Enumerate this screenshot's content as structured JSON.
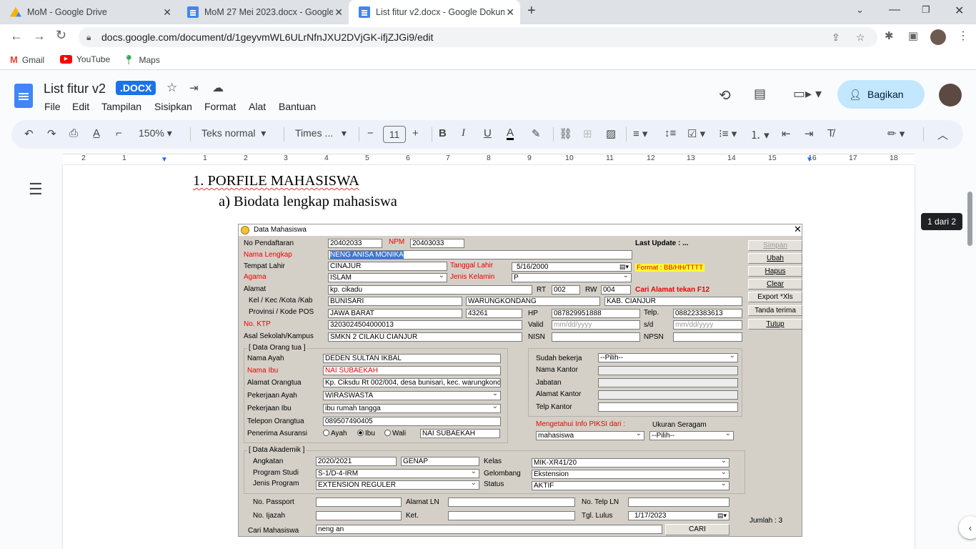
{
  "browser": {
    "tabs": [
      {
        "title": "MoM - Google Drive",
        "icon": "google-drive-icon"
      },
      {
        "title": "MoM 27 Mei 2023.docx - Google...",
        "icon": "google-docs-icon"
      },
      {
        "title": "List fitur v2.docx - Google Dokum...",
        "icon": "google-docs-icon"
      }
    ],
    "url": "docs.google.com/document/d/1geyvmWL6ULrNfnJXU2DVjGK-ifjZJGi9/edit",
    "bookmarks": [
      "Gmail",
      "YouTube",
      "Maps"
    ]
  },
  "docs": {
    "title": "List fitur v2",
    "badge": ".DOCX",
    "menu": [
      "File",
      "Edit",
      "Tampilan",
      "Sisipkan",
      "Format",
      "Alat",
      "Bantuan"
    ],
    "share_label": "Bagikan",
    "zoom": "150%",
    "style": "Teks normal",
    "font": "Times ...",
    "font_size": "11",
    "ruler_numbers": [
      "2",
      "1",
      "1",
      "2",
      "3",
      "4",
      "5",
      "6",
      "7",
      "8",
      "9",
      "10",
      "11",
      "12",
      "13",
      "14",
      "15",
      "16",
      "17",
      "18"
    ],
    "page_indicator": "1 dari 2",
    "heading": "1.   PORFILE MAHASISWA",
    "subheading": "a)   Biodata lengkap mahasiswa"
  },
  "app": {
    "title": "Data Mahasiswa",
    "labels": {
      "no_pendaftaran": "No Pendaftaran",
      "npm": "NPM",
      "last_update": "Last Update :  ...",
      "nama_lengkap": "Nama Lengkap",
      "tempat_lahir": "Tempat Lahir",
      "tanggal_lahir": "Tanggal Lahir",
      "format": "Format : BB/HH/TTTT",
      "agama": "Agama",
      "jenis_kelamin": "Jenis Kelamin",
      "alamat": "Alamat",
      "rt": "RT",
      "rw": "RW",
      "cari_alamat": "Cari Alamat  tekan F12",
      "kel_kec": "Kel / Kec /Kota /Kab",
      "provinsi": "Provinsi / Kode POS",
      "hp": "HP",
      "telp": "Telp.",
      "no_ktp": "No. KTP",
      "valid": "Valid",
      "sd": "s/d",
      "asal_sekolah": "Asal Sekolah/Kampus",
      "nisn": "NISN",
      "npsn": "NPSN",
      "grp_ortu": "[ Data Orang tua ]",
      "nama_ayah": "Nama Ayah",
      "nama_ibu": "Nama Ibu",
      "alamat_ortu": "Alamat Orangtua",
      "pekerjaan_ayah": "Pekerjaan Ayah",
      "pekerjaan_ibu": "Pekerjaan Ibu",
      "telepon_ortu": "Telepon Orangtua",
      "penerima_asuransi": "Penerima Asuransi",
      "r_ayah": "Ayah",
      "r_ibu": "Ibu",
      "r_wali": "Wali",
      "sudah_bekerja": "Sudah bekerja",
      "nama_kantor": "Nama Kantor",
      "jabatan": "Jabatan",
      "alamat_kantor": "Alamat Kantor",
      "telp_kantor": "Telp Kantor",
      "mengetahui": "Mengetahui Info PIKSI dari :",
      "ukuran_seragam": "Ukuran Seragam",
      "grp_akademik": "[ Data Akademik ]",
      "angkatan": "Angkatan",
      "kelas": "Kelas",
      "program_studi": "Program Studi",
      "gelombang": "Gelombang",
      "jenis_program": "Jenis Program",
      "status": "Status",
      "no_passport": "No. Passport",
      "alamat_ln": "Alamat LN",
      "no_telp_ln": "No. Telp LN",
      "no_ijazah": "No. Ijazah",
      "ket": "Ket.",
      "tgl_lulus": "Tgl. Lulus",
      "jumlah": "Jumlah : 3",
      "cari_mahasiswa": "Cari Mahasiswa"
    },
    "values": {
      "no_pendaftaran": "20402033",
      "npm": "20403033",
      "nama_lengkap": "NENG ANISA MONIKA",
      "tempat_lahir": "CINAJUR",
      "tanggal_lahir": "5/16/2000",
      "agama": "ISLAM",
      "jenis_kelamin": "P",
      "alamat": "kp. cikadu",
      "rt": "002",
      "rw": "004",
      "kel": "BUNISARI",
      "kec": "WARUNGKONDANG",
      "kab": "KAB. CIANJUR",
      "provinsi": "JAWA BARAT",
      "kode_pos": "43261",
      "hp": "087829951888",
      "telp": "088223383613",
      "no_ktp": "3203024504000013",
      "valid": "mm/dd/yyyy",
      "sd": "mm/dd/yyyy",
      "asal_sekolah": "SMKN 2 CILAKU CIANJUR",
      "nama_ayah": "DEDEN SULTAN IKBAL",
      "nama_ibu": "NAI SUBAEKAH",
      "alamat_ortu": "Kp. Ciksdu Rt 002/004, desa bunisari, kec. warungkondang",
      "pekerjaan_ayah": "WIRASWASTA",
      "pekerjaan_ibu": "ibu rumah tangga",
      "telepon_ortu": "089507490405",
      "penerima_asuransi": "NAI SUBAEKAH",
      "sudah_bekerja": "--Pilih--",
      "mengetahui": "mahasiswa",
      "ukuran_seragam": "--Pilih--",
      "angkatan": "2020/2021",
      "semester": "GENAP",
      "kelas": "MIK-XR41/20",
      "program_studi": "S-1/D-4-IRM",
      "gelombang": "Ekstension",
      "jenis_program": "EXTENSION REGULER",
      "status": "AKTIF",
      "tgl_lulus": "1/17/2023",
      "cari": "neng an"
    },
    "buttons": [
      "Simpan",
      "Ubah",
      "Hapus",
      "Clear",
      "Export *Xls",
      "Tanda terima",
      "Tutup"
    ],
    "cari_button": "CARI"
  }
}
